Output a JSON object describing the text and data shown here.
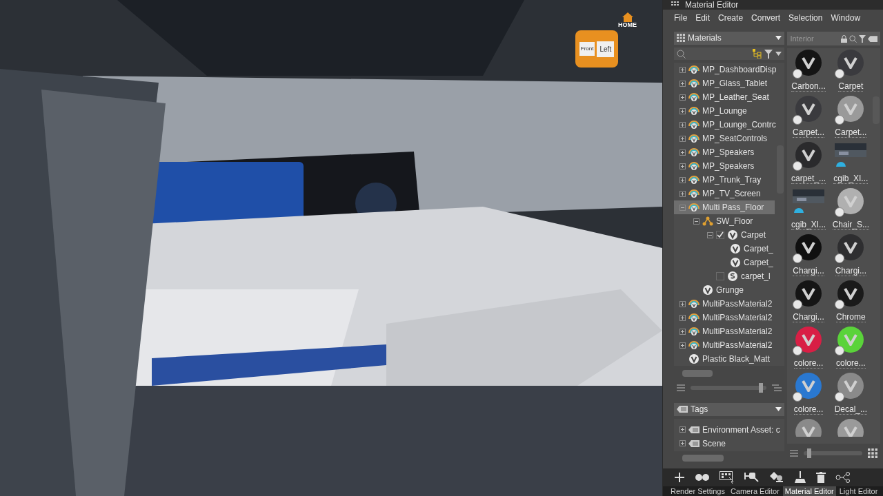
{
  "viewcube": {
    "home": "HOME",
    "front": "Front",
    "left": "Left"
  },
  "panel": {
    "title": "Material Editor",
    "menu": [
      "File",
      "Edit",
      "Create",
      "Convert",
      "Selection",
      "Window"
    ],
    "library_dropdown": "Materials",
    "tree": [
      {
        "label": "MP_DashboardDisp",
        "kind": "multipass",
        "expanded": false,
        "selected": false
      },
      {
        "label": "MP_Glass_Tablet",
        "kind": "multipass",
        "expanded": false,
        "selected": false
      },
      {
        "label": "MP_Leather_Seat",
        "kind": "multipass",
        "expanded": false,
        "selected": false
      },
      {
        "label": "MP_Lounge",
        "kind": "multipass",
        "expanded": false,
        "selected": false
      },
      {
        "label": "MP_Lounge_Contrc",
        "kind": "multipass",
        "expanded": false,
        "selected": false
      },
      {
        "label": "MP_SeatControls",
        "kind": "multipass",
        "expanded": false,
        "selected": false
      },
      {
        "label": "MP_Speakers",
        "kind": "multipass",
        "expanded": false,
        "selected": false
      },
      {
        "label": "MP_Speakers",
        "kind": "multipass",
        "expanded": false,
        "selected": false
      },
      {
        "label": "MP_Trunk_Tray",
        "kind": "multipass",
        "expanded": false,
        "selected": false
      },
      {
        "label": "MP_TV_Screen",
        "kind": "multipass",
        "expanded": false,
        "selected": false
      },
      {
        "label": "Multi Pass_Floor",
        "kind": "multipass",
        "expanded": true,
        "selected": true,
        "children": [
          {
            "label": "SW_Floor",
            "kind": "group",
            "expanded": true,
            "selected": false,
            "children": [
              {
                "label": "Carpet",
                "kind": "material",
                "checked": true,
                "expanded": true,
                "selected": false,
                "children": [
                  {
                    "label": "Carpet_",
                    "kind": "material",
                    "selected": false
                  },
                  {
                    "label": "Carpet_",
                    "kind": "material",
                    "selected": false
                  }
                ]
              },
              {
                "label": "carpet_l",
                "kind": "switch",
                "checked": false,
                "selected": false
              }
            ]
          },
          {
            "label": "Grunge",
            "kind": "material",
            "selected": false
          }
        ]
      },
      {
        "label": "MultiPassMaterial2",
        "kind": "multipass",
        "expanded": false,
        "selected": false
      },
      {
        "label": "MultiPassMaterial2",
        "kind": "multipass",
        "expanded": false,
        "selected": false
      },
      {
        "label": "MultiPassMaterial2",
        "kind": "multipass",
        "expanded": false,
        "selected": false
      },
      {
        "label": "MultiPassMaterial2",
        "kind": "multipass",
        "expanded": false,
        "selected": false
      },
      {
        "label": "Plastic Black_Matt",
        "kind": "material",
        "selected": false
      }
    ],
    "tree_zoom": {
      "level": 0.95
    },
    "thumb_zoom": {
      "level": 0.05
    },
    "tags_dropdown": "Tags",
    "tags": [
      {
        "label": "Environment Asset: c",
        "expanded": false
      },
      {
        "label": "Scene",
        "expanded": false
      }
    ],
    "filter_field": "Interior",
    "thumbnails": [
      {
        "label": "Carbon...",
        "kind": "sphere",
        "color": "#151515"
      },
      {
        "label": "Carpet",
        "kind": "sphere",
        "color": "#3a3a3e"
      },
      {
        "label": "Carpet...",
        "kind": "sphere",
        "color": "#3a3a3e"
      },
      {
        "label": "Carpet...",
        "kind": "sphere",
        "color": "#9a9a9a"
      },
      {
        "label": "carpet_...",
        "kind": "sphere",
        "color": "#2a2a2c"
      },
      {
        "label": "cgib_XI..."
      },
      {
        "label": "cgib_XI..."
      },
      {
        "label": "Chair_S...",
        "kind": "sphere",
        "color": "#b0b0b0"
      },
      {
        "label": "Chargi...",
        "kind": "sphere",
        "color": "#101010"
      },
      {
        "label": "Chargi...",
        "kind": "sphere",
        "color": "#2e2e30"
      },
      {
        "label": "Chargi...",
        "kind": "sphere",
        "color": "#151515"
      },
      {
        "label": "Chrome",
        "kind": "sphere",
        "color": "#1a1a1a"
      },
      {
        "label": "colore...",
        "kind": "sphere",
        "color": "#d81f45"
      },
      {
        "label": "colore...",
        "kind": "sphere",
        "color": "#5ad33a"
      },
      {
        "label": "colore...",
        "kind": "sphere",
        "color": "#2a78d0"
      },
      {
        "label": "Decal_...",
        "kind": "sphere",
        "color": "#8a8a8a"
      },
      {
        "kind": "sphere",
        "color": "#8a8a8a"
      },
      {
        "kind": "sphere",
        "color": "#9a9a9a"
      }
    ],
    "bottom_tabs": [
      {
        "label": "Render Settings",
        "selected": false
      },
      {
        "label": "Camera Editor",
        "selected": false
      },
      {
        "label": "Material Editor",
        "selected": true
      },
      {
        "label": "Light Editor",
        "selected": false
      }
    ]
  }
}
